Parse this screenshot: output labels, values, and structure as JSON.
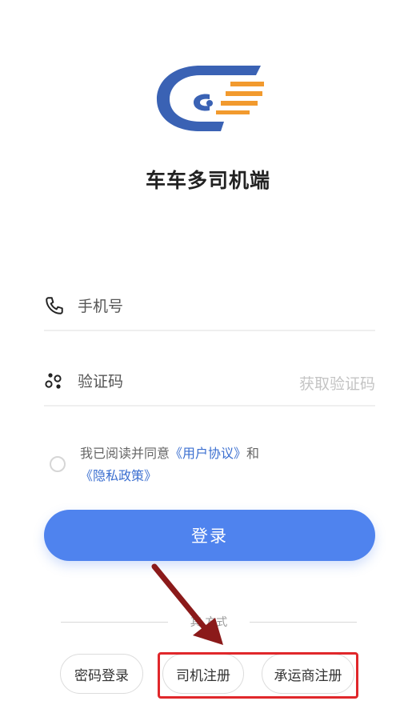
{
  "app": {
    "title": "车车多司机端"
  },
  "form": {
    "phone_placeholder": "手机号",
    "code_placeholder": "验证码",
    "get_code_label": "获取验证码"
  },
  "agreement": {
    "prefix": "我已阅读并同意",
    "user_agreement": "《用户协议》",
    "and": "和",
    "privacy_policy": "《隐私政策》"
  },
  "login_button": "登录",
  "other_methods": {
    "label_visible_part": "其 方式",
    "buttons": {
      "password_login": "密码登录",
      "driver_register": "司机注册",
      "carrier_register": "承运商注册"
    }
  },
  "colors": {
    "brand_blue": "#4f83ee",
    "logo_blue": "#3a62b4",
    "logo_orange": "#f29a2e",
    "link_blue": "#3b6fd0",
    "highlight_red": "#e0272b",
    "arrow_dark_red": "#8b1a1a"
  },
  "icons": [
    "logo-icon",
    "phone-icon",
    "verify-code-icon",
    "radio-unchecked-icon",
    "annotation-arrow-icon"
  ]
}
